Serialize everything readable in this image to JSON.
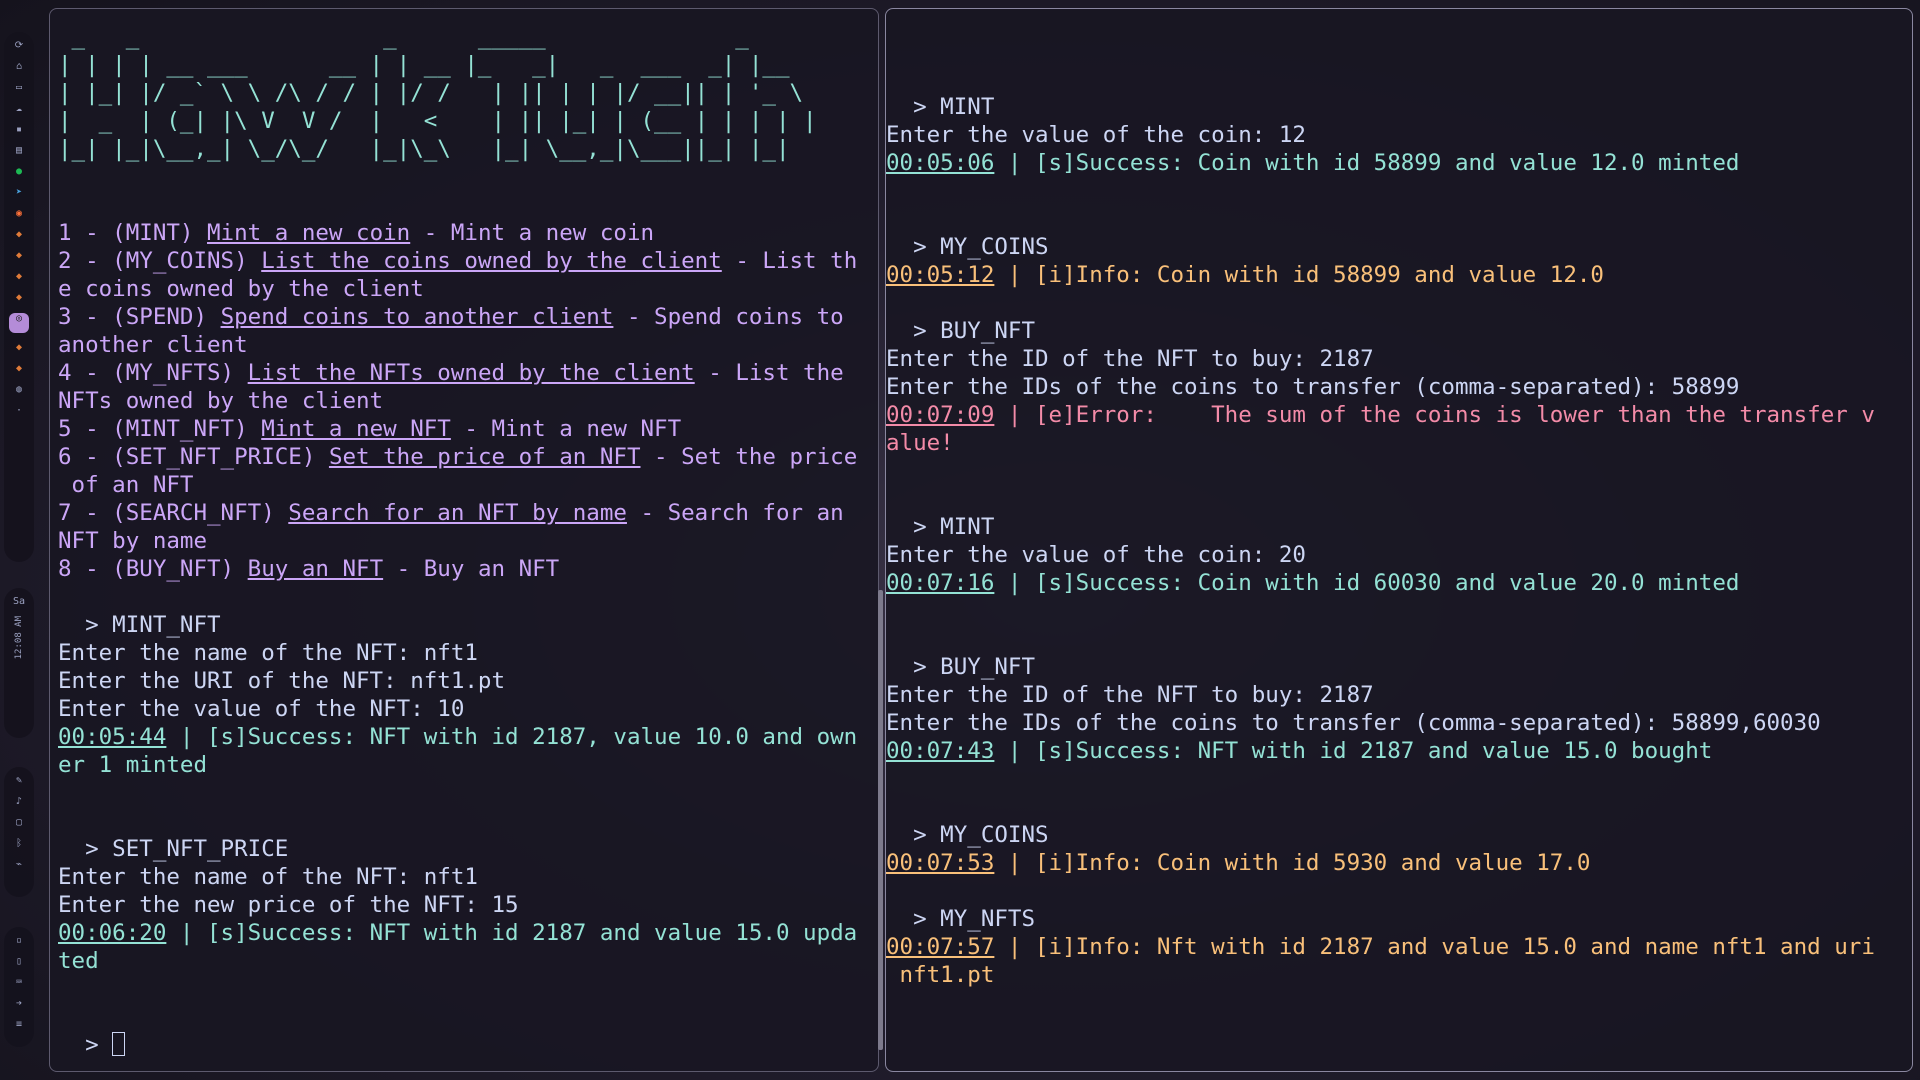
{
  "sidebar": {
    "icons": [
      "refresh-icon",
      "home-icon",
      "window-icon",
      "cloud-icon",
      "folder-icon",
      "photos-icon",
      "spotify-icon",
      "telegram-icon",
      "firefox-icon",
      "game-icon",
      "game-icon",
      "game-icon",
      "game-icon",
      "active-app-icon",
      "game-icon",
      "game-icon",
      "disk-icon",
      "dot-icon"
    ],
    "clock_short": "12:08 AM",
    "clock_day": "Sa",
    "tray_icons": [
      "edit-icon",
      "mic-icon",
      "screen-icon",
      "bluetooth-icon",
      "network-icon"
    ],
    "bottom_icons": [
      "bell-icon",
      "battery-icon",
      "keyboard-icon",
      "arrow-icon",
      "menu-icon"
    ]
  },
  "left_terminal": {
    "banner": [
      " _   _                  _      _____              _",
      "| | | | __ ___      __ | | __ |_   _|   _  ___  _| |__",
      "| |_| |/ _` \\ \\ /\\ / / | |/ /   | || | | |/ __|| | '_ \\",
      "|  _  | (_| |\\ V  V /  |   <    | || |_| | (__ | | | | |",
      "|_| |_|\\__,_| \\_/\\_/   |_|\\_\\   |_| \\__,_|\\___||_| |_|"
    ],
    "menu": [
      {
        "num": "1 - (MINT) ",
        "link": "Mint a new coin",
        "desc": " - Mint a new coin"
      },
      {
        "num": "2 - (MY_COINS) ",
        "link": "List the coins owned by the client",
        "desc": " - List th"
      },
      {
        "num": "",
        "link": "",
        "desc": "e coins owned by the client"
      },
      {
        "num": "3 - (SPEND) ",
        "link": "Spend coins to another client",
        "desc": " - Spend coins to"
      },
      {
        "num": "",
        "link": "",
        "desc": "another client"
      },
      {
        "num": "4 - (MY_NFTS) ",
        "link": "List the NFTs owned by the client",
        "desc": " - List the"
      },
      {
        "num": "",
        "link": "",
        "desc": "NFTs owned by the client"
      },
      {
        "num": "5 - (MINT_NFT) ",
        "link": "Mint a new NFT",
        "desc": " - Mint a new NFT"
      },
      {
        "num": "6 - (SET_NFT_PRICE) ",
        "link": "Set the price of an NFT",
        "desc": " - Set the price"
      },
      {
        "num": "",
        "link": "",
        "desc": " of an NFT"
      },
      {
        "num": "7 - (SEARCH_NFT) ",
        "link": "Search for an NFT by name",
        "desc": " - Search for an"
      },
      {
        "num": "",
        "link": "",
        "desc": "NFT by name"
      },
      {
        "num": "8 - (BUY_NFT) ",
        "link": "Buy an NFT",
        "desc": " - Buy an NFT"
      }
    ],
    "session": [
      {
        "k": "blank"
      },
      {
        "k": "prompt",
        "t": "  > MINT_NFT"
      },
      {
        "k": "txt",
        "t": "Enter the name of the NFT: nft1"
      },
      {
        "k": "txt",
        "t": "Enter the URI of the NFT: nft1.pt"
      },
      {
        "k": "txt",
        "t": "Enter the value of the NFT: 10"
      },
      {
        "k": "log",
        "c": "succ",
        "ts": "00:05:44",
        "t": " | [s]Success: NFT with id 2187, value 10.0 and own"
      },
      {
        "k": "plain",
        "c": "succ",
        "t": "er 1 minted"
      },
      {
        "k": "blank"
      },
      {
        "k": "blank"
      },
      {
        "k": "prompt",
        "t": "  > SET_NFT_PRICE"
      },
      {
        "k": "txt",
        "t": "Enter the name of the NFT: nft1"
      },
      {
        "k": "txt",
        "t": "Enter the new price of the NFT: 15"
      },
      {
        "k": "log",
        "c": "succ",
        "ts": "00:06:20",
        "t": " | [s]Success: NFT with id 2187 and value 15.0 upda"
      },
      {
        "k": "plain",
        "c": "succ",
        "t": "ted"
      },
      {
        "k": "blank"
      },
      {
        "k": "blank"
      }
    ],
    "input_prompt": "  > "
  },
  "right_terminal": {
    "session": [
      {
        "k": "blank"
      },
      {
        "k": "blank"
      },
      {
        "k": "prompt",
        "t": "  > MINT"
      },
      {
        "k": "txt",
        "t": "Enter the value of the coin: 12"
      },
      {
        "k": "log",
        "c": "succ",
        "ts": "00:05:06",
        "t": " | [s]Success: Coin with id 58899 and value 12.0 minted"
      },
      {
        "k": "blank"
      },
      {
        "k": "blank"
      },
      {
        "k": "prompt",
        "t": "  > MY_COINS"
      },
      {
        "k": "log",
        "c": "info",
        "ts": "00:05:12",
        "t": " | [i]Info: Coin with id 58899 and value 12.0"
      },
      {
        "k": "blank"
      },
      {
        "k": "prompt",
        "t": "  > BUY_NFT"
      },
      {
        "k": "txt",
        "t": "Enter the ID of the NFT to buy: 2187"
      },
      {
        "k": "txt",
        "t": "Enter the IDs of the coins to transfer (comma-separated): 58899"
      },
      {
        "k": "log",
        "c": "err",
        "ts": "00:07:09",
        "t": " | [e]Error:    The sum of the coins is lower than the transfer v"
      },
      {
        "k": "plain",
        "c": "err",
        "t": "alue!"
      },
      {
        "k": "blank"
      },
      {
        "k": "blank"
      },
      {
        "k": "prompt",
        "t": "  > MINT"
      },
      {
        "k": "txt",
        "t": "Enter the value of the coin: 20"
      },
      {
        "k": "log",
        "c": "succ",
        "ts": "00:07:16",
        "t": " | [s]Success: Coin with id 60030 and value 20.0 minted"
      },
      {
        "k": "blank"
      },
      {
        "k": "blank"
      },
      {
        "k": "prompt",
        "t": "  > BUY_NFT"
      },
      {
        "k": "txt",
        "t": "Enter the ID of the NFT to buy: 2187"
      },
      {
        "k": "txt",
        "t": "Enter the IDs of the coins to transfer (comma-separated): 58899,60030"
      },
      {
        "k": "log",
        "c": "succ",
        "ts": "00:07:43",
        "t": " | [s]Success: NFT with id 2187 and value 15.0 bought"
      },
      {
        "k": "blank"
      },
      {
        "k": "blank"
      },
      {
        "k": "prompt",
        "t": "  > MY_COINS"
      },
      {
        "k": "log",
        "c": "info",
        "ts": "00:07:53",
        "t": " | [i]Info: Coin with id 5930 and value 17.0"
      },
      {
        "k": "blank"
      },
      {
        "k": "prompt",
        "t": "  > MY_NFTS"
      },
      {
        "k": "log",
        "c": "info",
        "ts": "00:07:57",
        "t": " | [i]Info: Nft with id 2187 and value 15.0 and name nft1 and uri"
      },
      {
        "k": "plain",
        "c": "info",
        "t": " nft1.pt"
      },
      {
        "k": "blank"
      },
      {
        "k": "blank"
      },
      {
        "k": "blank"
      }
    ],
    "input_prompt": "  > "
  }
}
